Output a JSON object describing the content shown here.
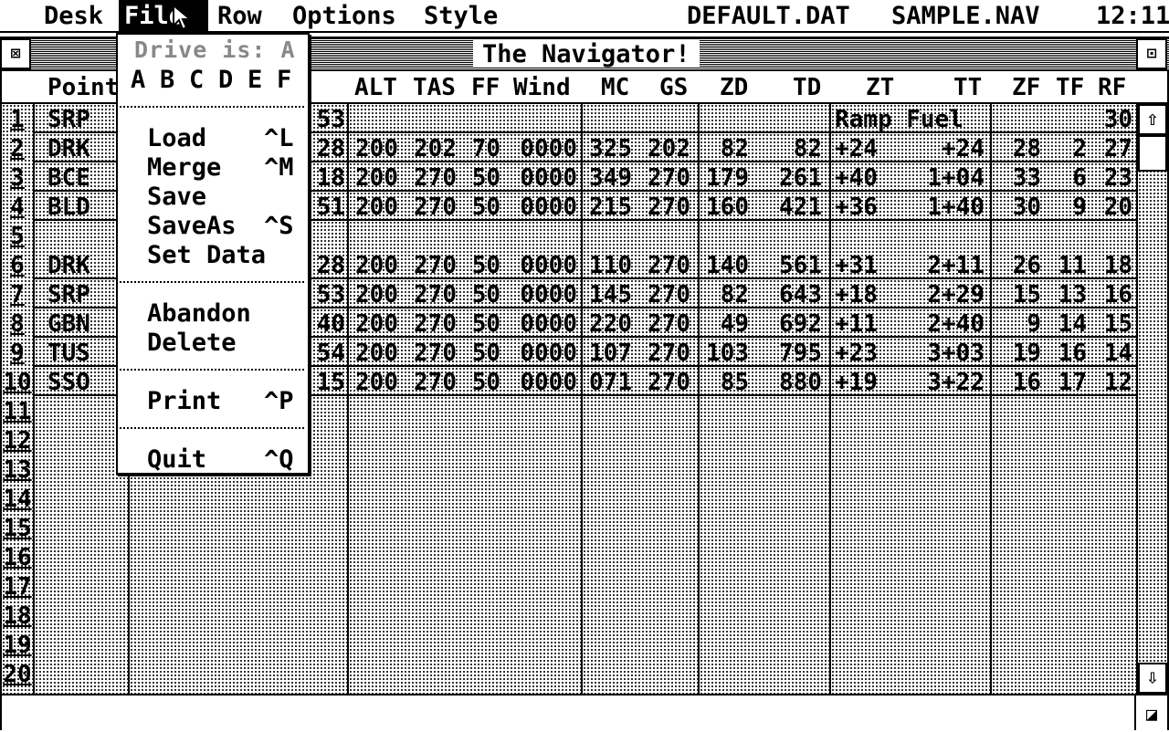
{
  "menubar": {
    "desk": "Desk",
    "file": "File",
    "row": "Row",
    "options": "Options",
    "style": "Style",
    "file1": "DEFAULT.DAT",
    "file2": "SAMPLE.NAV",
    "clock": "12:11"
  },
  "window": {
    "title": "The Navigator!",
    "close_glyph": "⊠",
    "full_glyph": "⊡"
  },
  "columns": [
    "Point",
    "",
    "ALT",
    "TAS",
    "FF",
    "Wind",
    "MC",
    "GS",
    "ZD",
    "TD",
    "ZT",
    "TT",
    "ZF",
    "TF",
    "RF"
  ],
  "rows": [
    {
      "n": "1",
      "point": "SRP",
      "c2": "53",
      "alt": "",
      "tas": "",
      "ff": "",
      "wind": "",
      "mc": "",
      "gs": "",
      "zd": "",
      "td": "",
      "zt": "Ramp Fuel",
      "tt": "",
      "zf": "",
      "tf": "",
      "rf": "30"
    },
    {
      "n": "2",
      "point": "DRK",
      "c2": "28",
      "alt": "200",
      "tas": "202",
      "ff": "70",
      "wind": "0000",
      "mc": "325",
      "gs": "202",
      "zd": "82",
      "td": "82",
      "zt": "+24",
      "tt": "+24",
      "zf": "28",
      "tf": "2",
      "rf": "27"
    },
    {
      "n": "3",
      "point": "BCE",
      "c2": "18",
      "alt": "200",
      "tas": "270",
      "ff": "50",
      "wind": "0000",
      "mc": "349",
      "gs": "270",
      "zd": "179",
      "td": "261",
      "zt": "+40",
      "tt": "1+04",
      "zf": "33",
      "tf": "6",
      "rf": "23"
    },
    {
      "n": "4",
      "point": "BLD",
      "c2": "51",
      "alt": "200",
      "tas": "270",
      "ff": "50",
      "wind": "0000",
      "mc": "215",
      "gs": "270",
      "zd": "160",
      "td": "421",
      "zt": "+36",
      "tt": "1+40",
      "zf": "30",
      "tf": "9",
      "rf": "20"
    },
    {
      "n": "5",
      "point": "",
      "c2": "",
      "alt": "",
      "tas": "",
      "ff": "",
      "wind": "",
      "mc": "",
      "gs": "",
      "zd": "",
      "td": "",
      "zt": "",
      "tt": "",
      "zf": "",
      "tf": "",
      "rf": ""
    },
    {
      "n": "6",
      "point": "DRK",
      "c2": "28",
      "alt": "200",
      "tas": "270",
      "ff": "50",
      "wind": "0000",
      "mc": "110",
      "gs": "270",
      "zd": "140",
      "td": "561",
      "zt": "+31",
      "tt": "2+11",
      "zf": "26",
      "tf": "11",
      "rf": "18"
    },
    {
      "n": "7",
      "point": "SRP",
      "c2": "53",
      "alt": "200",
      "tas": "270",
      "ff": "50",
      "wind": "0000",
      "mc": "145",
      "gs": "270",
      "zd": "82",
      "td": "643",
      "zt": "+18",
      "tt": "2+29",
      "zf": "15",
      "tf": "13",
      "rf": "16"
    },
    {
      "n": "8",
      "point": "GBN",
      "c2": "40",
      "alt": "200",
      "tas": "270",
      "ff": "50",
      "wind": "0000",
      "mc": "220",
      "gs": "270",
      "zd": "49",
      "td": "692",
      "zt": "+11",
      "tt": "2+40",
      "zf": "9",
      "tf": "14",
      "rf": "15"
    },
    {
      "n": "9",
      "point": "TUS",
      "c2": "54",
      "alt": "200",
      "tas": "270",
      "ff": "50",
      "wind": "0000",
      "mc": "107",
      "gs": "270",
      "zd": "103",
      "td": "795",
      "zt": "+23",
      "tt": "3+03",
      "zf": "19",
      "tf": "16",
      "rf": "14"
    },
    {
      "n": "10",
      "point": "SSO",
      "c2": "15",
      "alt": "200",
      "tas": "270",
      "ff": "50",
      "wind": "0000",
      "mc": "071",
      "gs": "270",
      "zd": "85",
      "td": "880",
      "zt": "+19",
      "tt": "3+22",
      "zf": "16",
      "tf": "17",
      "rf": "12"
    },
    {
      "n": "11"
    },
    {
      "n": "12"
    },
    {
      "n": "13"
    },
    {
      "n": "14"
    },
    {
      "n": "15"
    },
    {
      "n": "16"
    },
    {
      "n": "17"
    },
    {
      "n": "18"
    },
    {
      "n": "19"
    },
    {
      "n": "20"
    }
  ],
  "file_menu": {
    "drive_label": "Drive is: A",
    "drives": [
      "A",
      "B",
      "C",
      "D",
      "E",
      "F"
    ],
    "items": [
      {
        "label": "Load",
        "shortcut": "^L"
      },
      {
        "label": "Merge",
        "shortcut": "^M"
      },
      {
        "label": "Save",
        "shortcut": ""
      },
      {
        "label": "SaveAs",
        "shortcut": "^S"
      },
      {
        "label": "Set Data",
        "shortcut": ""
      },
      {
        "label": "Abandon",
        "shortcut": ""
      },
      {
        "label": "Delete",
        "shortcut": ""
      },
      {
        "label": "Print",
        "shortcut": "^P"
      },
      {
        "label": "Quit",
        "shortcut": "^Q"
      }
    ]
  },
  "scroll": {
    "up": "⇧",
    "down": "⇩"
  },
  "sizebox_glyph": "◪"
}
